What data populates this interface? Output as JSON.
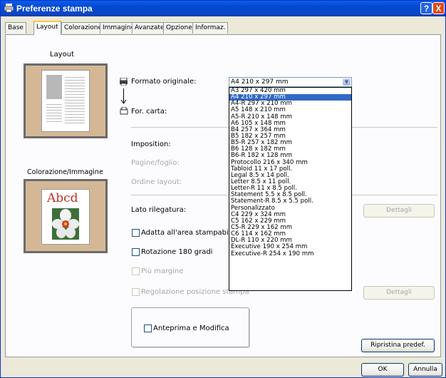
{
  "window": {
    "title": "Preferenze stampa",
    "help_label": "?",
    "close_label": "X"
  },
  "tabs": [
    {
      "label": "Base"
    },
    {
      "label": "Layout"
    },
    {
      "label": "Colorazione"
    },
    {
      "label": "Immagine"
    },
    {
      "label": "Avanzate"
    },
    {
      "label": "Opzione"
    },
    {
      "label": "Informaz."
    }
  ],
  "left": {
    "layout_label": "Layout",
    "color_label": "Colorazione/Immagine",
    "sample_text": "Abcd"
  },
  "form": {
    "formato_label": "Formato originale:",
    "formato_value": "A4 210 x 297 mm",
    "carta_label": "For. carta:",
    "imposition_label": "Imposition:",
    "pagine_label": "Pagine/foglio:",
    "ordine_label": "Ordine layout:",
    "rilegatura_label": "Lato rilegatura:",
    "dettagli_label": "Dettagli",
    "dettagli2_label": "Dettagli",
    "adatta_label": "Adatta all'area stampabile",
    "rotazione_label": "Rotazione 180 gradi",
    "margine_label": "Più margine",
    "regolazione_label": "Regolazione posizione stampa",
    "anteprima_label": "Anteprima e Modifica",
    "ripristina_label": "Ripristina predef."
  },
  "paper_options": [
    "A3 297 x 420 mm",
    "A4 210 x 297 mm",
    "A4-R 297 x 210 mm",
    "A5 148 x 210 mm",
    "A5-R 210 x 148 mm",
    "A6 105 x 148 mm",
    "B4 257 x 364 mm",
    "B5 182 x 257 mm",
    "B5-R 257 x 182 mm",
    "B6 128 x 182 mm",
    "B6-R 182 x 128 mm",
    "Protocollo 216 x 340 mm",
    "Tabloid 11 x 17 poll.",
    "Legal 8.5 x 14 poll.",
    "Letter 8.5 x 11 poll.",
    "Letter-R 11 x 8.5 poll.",
    "Statement 5.5 x 8.5 poll.",
    "Statement-R 8.5 x 5.5 poll.",
    "Personalizzato",
    "C4 229 x 324 mm",
    "C5 162 x 229 mm",
    "C5-R 229 x 162 mm",
    "C6 114 x 162 mm",
    "DL-R 110 x 220 mm",
    "Executive 190 x 254 mm",
    "Executive-R 254 x 190 mm"
  ],
  "selected_option": "A4 210 x 297 mm",
  "footer": {
    "ok_label": "OK",
    "cancel_label": "Annulla"
  },
  "colors": {
    "titlebar": "#0a5fe6",
    "selection": "#316ac5",
    "preview_bg": "#d4b896"
  }
}
